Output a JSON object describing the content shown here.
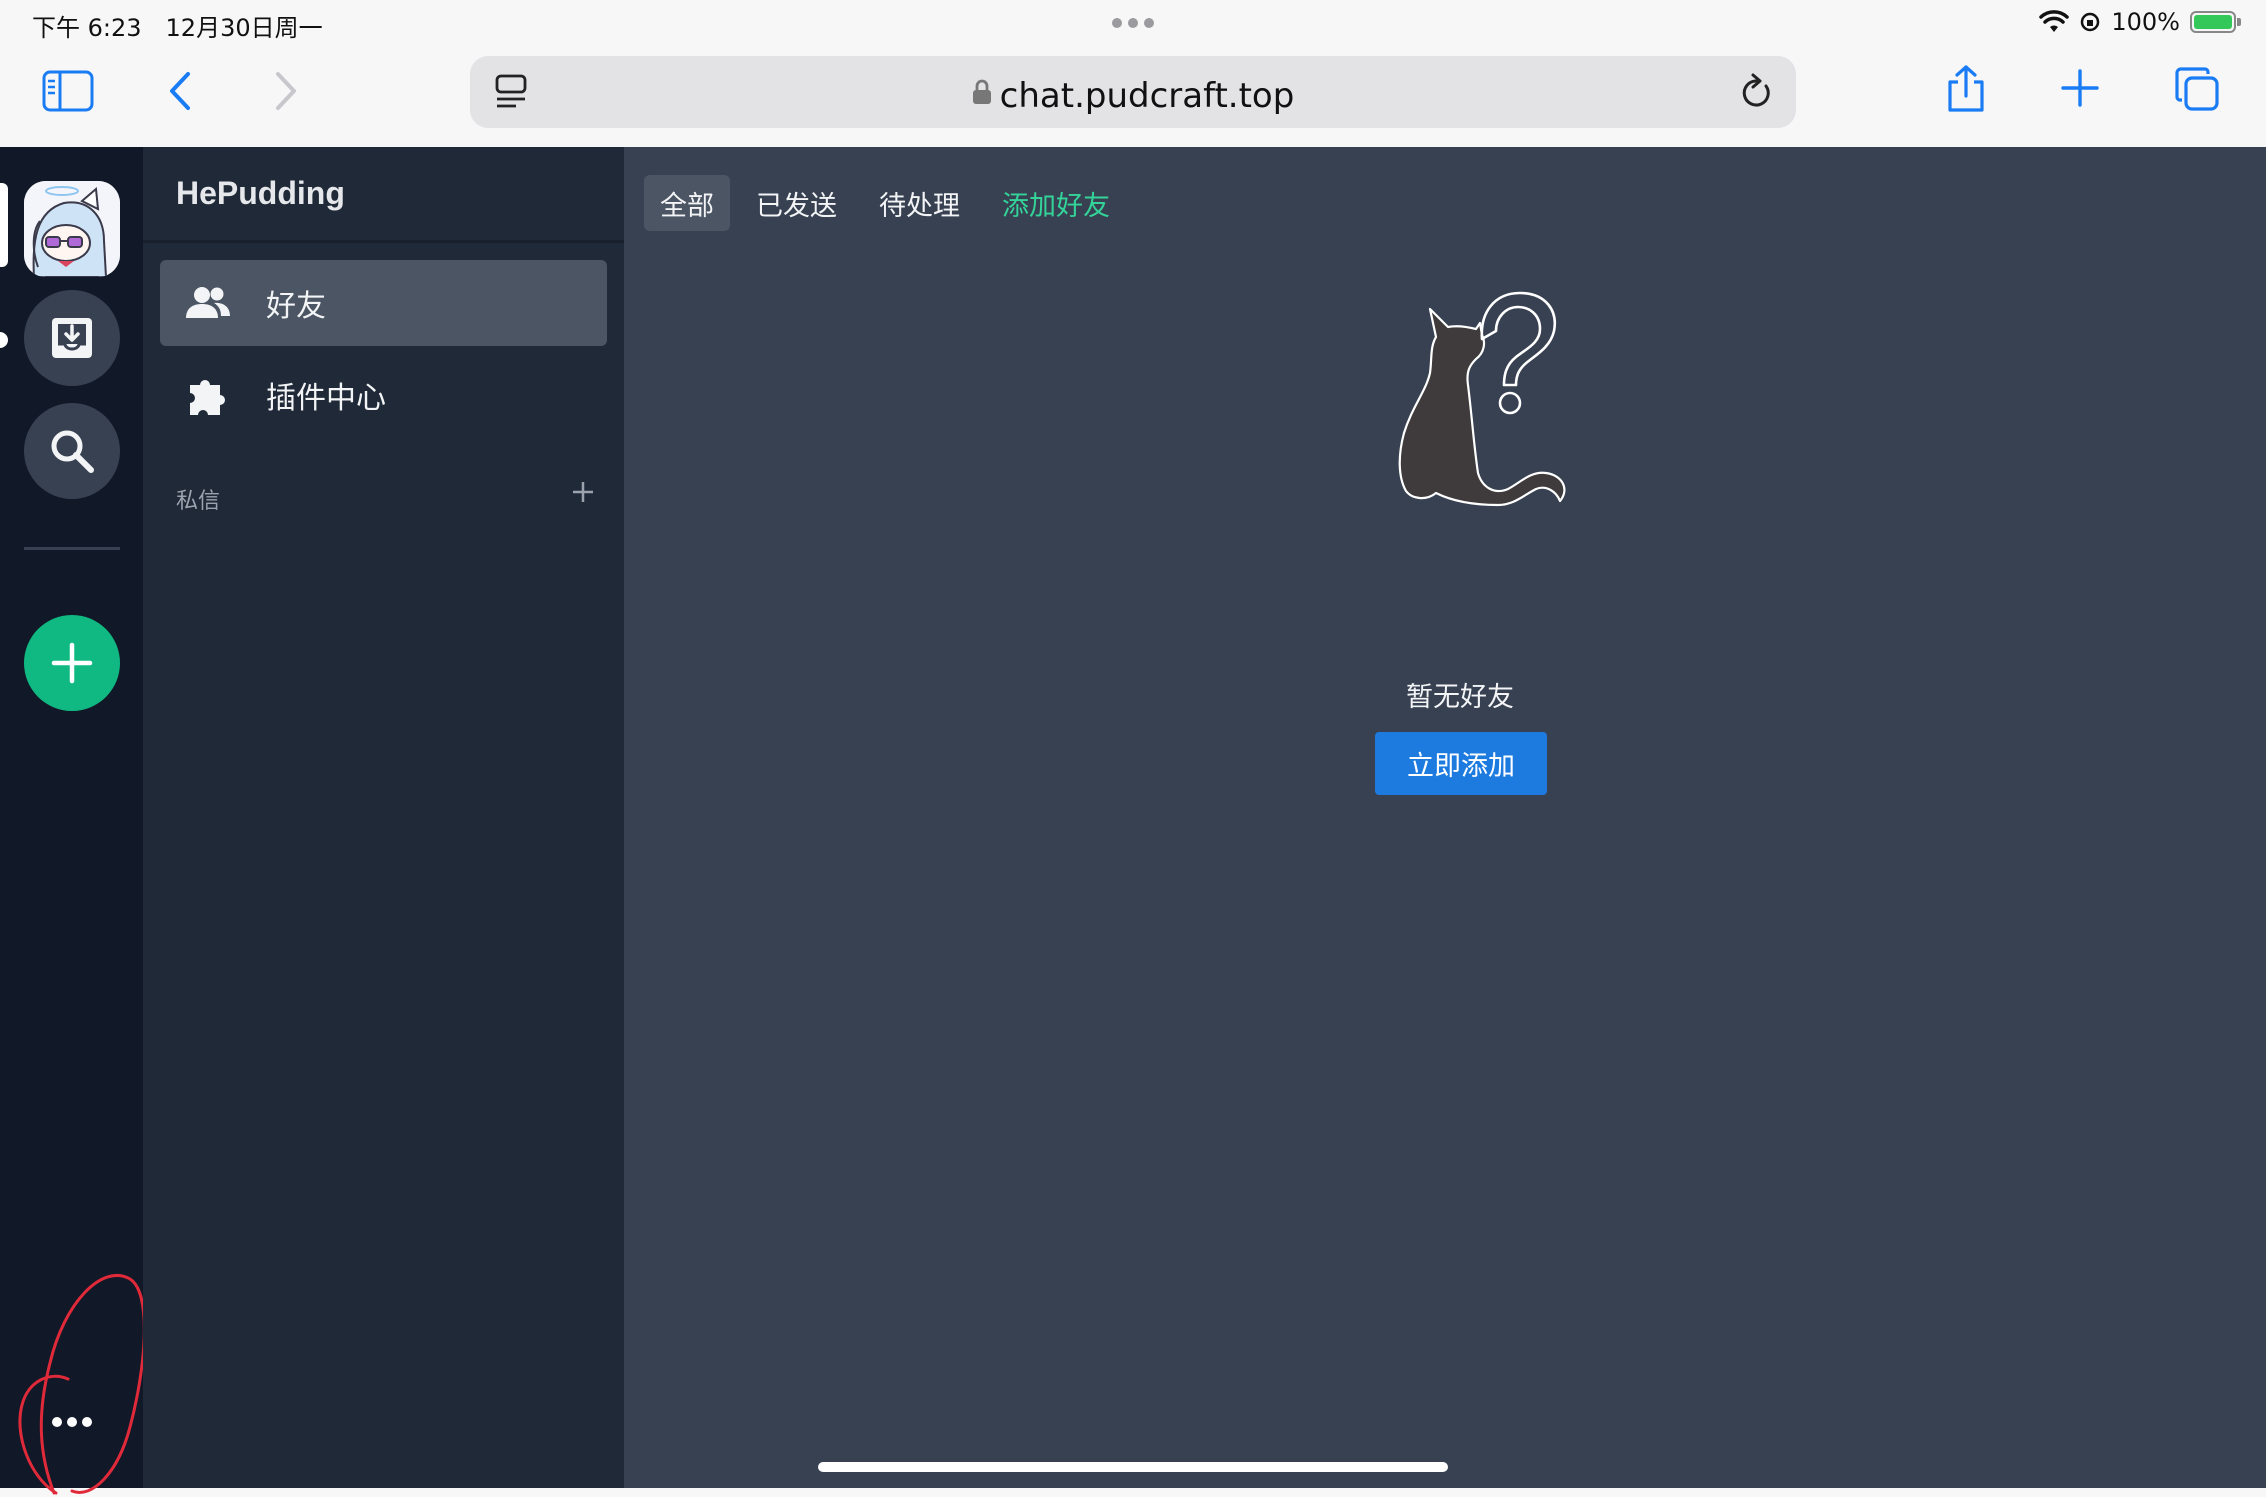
{
  "status_bar": {
    "time": "下午 6:23",
    "date": "12月30日周一",
    "battery": "100%",
    "battery_level": 1.0
  },
  "browser": {
    "url": "chat.pudcraft.top"
  },
  "sidebar": {
    "server_name": "HePudding",
    "items": [
      {
        "label": "好友",
        "icon": "friends-icon",
        "active": true
      },
      {
        "label": "插件中心",
        "icon": "puzzle-icon",
        "active": false
      }
    ],
    "dm_section_label": "私信"
  },
  "main": {
    "tabs": [
      {
        "label": "全部",
        "active": true
      },
      {
        "label": "已发送",
        "active": false
      },
      {
        "label": "待处理",
        "active": false
      },
      {
        "label": "添加好友",
        "active": false
      }
    ],
    "empty_text": "暂无好友",
    "add_button_label": "立即添加"
  },
  "colors": {
    "rail_bg": "#111827",
    "sidebar_bg": "#1f2937",
    "main_bg": "#374151",
    "accent_green": "#10b981",
    "primary_blue": "#1d7be0",
    "ios_blue": "#1a7cf5"
  }
}
